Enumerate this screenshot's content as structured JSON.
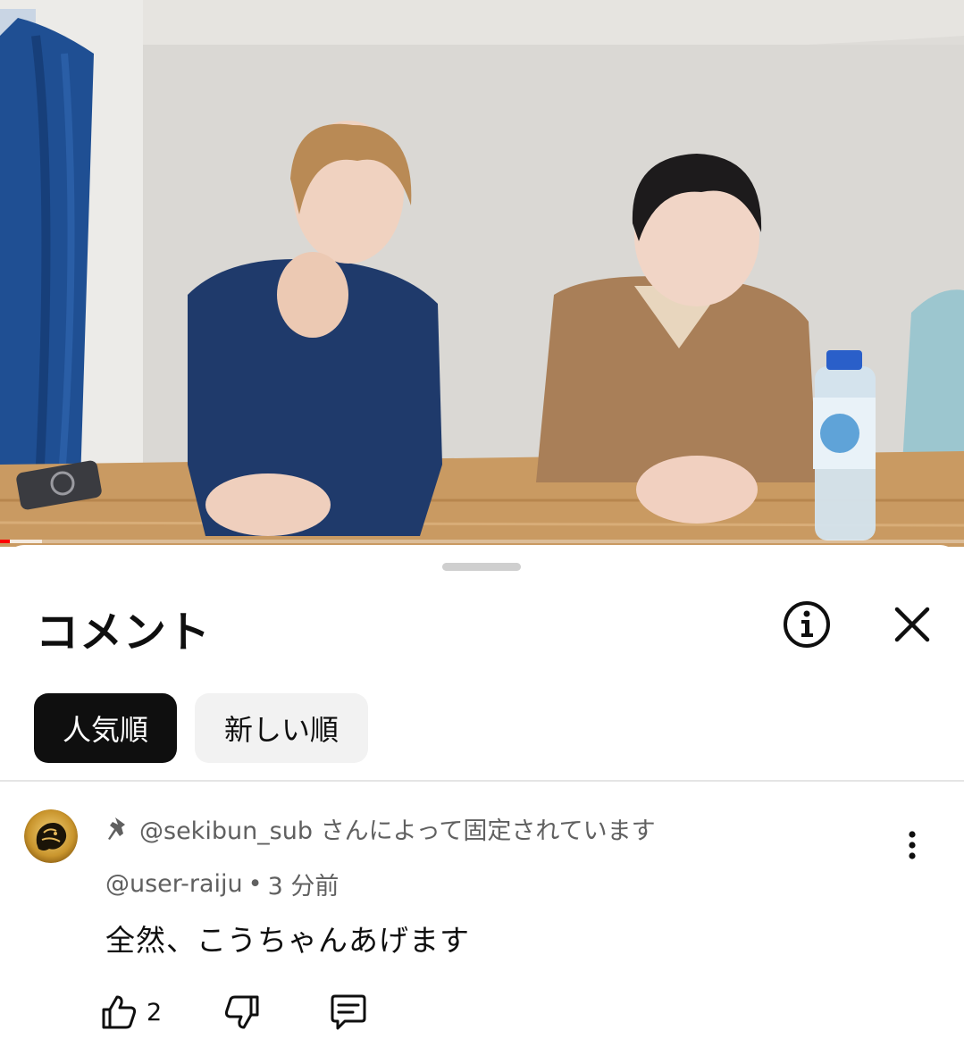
{
  "video": {
    "progress_fraction": 0.01,
    "buffered_fraction": 0.043
  },
  "sheet": {
    "title": "コメント",
    "info_icon": "info-circle-icon",
    "close_icon": "close-icon"
  },
  "sort_chips": [
    {
      "label": "人気順",
      "selected": true
    },
    {
      "label": "新しい順",
      "selected": false
    }
  ],
  "comment": {
    "pinned_text": "@sekibun_sub さんによって固定されています",
    "author": "@user-raiju",
    "separator": "•",
    "time": "3 分前",
    "text": "全然、こうちゃんあげます",
    "like_count": "2",
    "icons": {
      "pin": "pin-icon",
      "like": "thumbs-up-icon",
      "dislike": "thumbs-down-icon",
      "reply": "reply-icon",
      "more": "more-vertical-icon"
    }
  },
  "colors": {
    "accent": "#ff0000",
    "chip_active_bg": "#0f0f0f",
    "chip_inactive_bg": "#f2f2f2",
    "secondary_text": "#606060"
  }
}
